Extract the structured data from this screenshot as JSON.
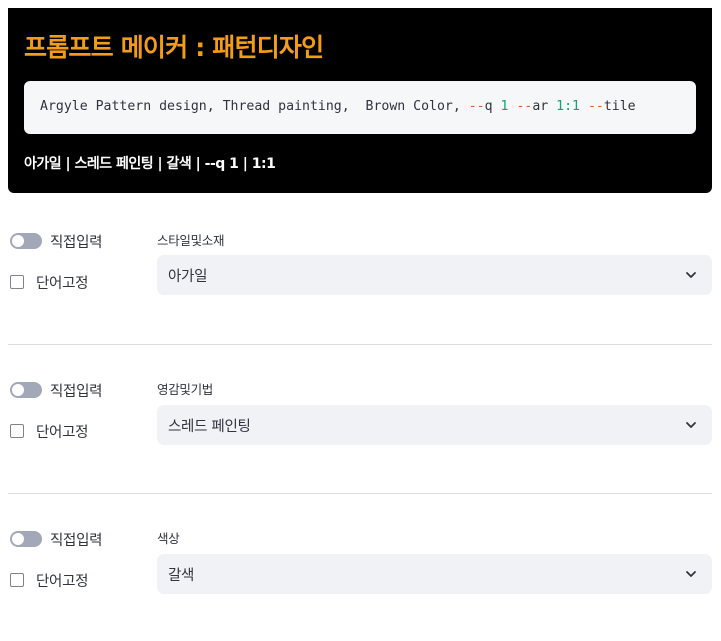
{
  "header": {
    "title": "프롬프트 메이커 : 패턴디자인",
    "code": {
      "text1": "Argyle Pattern design, Thread painting,  Brown Color, ",
      "op1": "--",
      "kw1": "q ",
      "num1": "1",
      "space1": " ",
      "op2": "--",
      "kw2": "ar ",
      "num2": "1:1",
      "space2": " ",
      "op3": "--",
      "kw3": "tile"
    },
    "summary": "아가일 | 스레드 페인팅 | 갈색 | --q 1 | 1:1"
  },
  "sections": [
    {
      "toggle_label": "직접입력",
      "checkbox_label": "단어고정",
      "field_label": "스타일및소재",
      "selected_value": "아가일"
    },
    {
      "toggle_label": "직접입력",
      "checkbox_label": "단어고정",
      "field_label": "영감및기법",
      "selected_value": "스레드 페인팅"
    },
    {
      "toggle_label": "직접입력",
      "checkbox_label": "단어고정",
      "field_label": "색상",
      "selected_value": "갈색"
    }
  ],
  "icons": {
    "chevron": "chevron-down-icon"
  },
  "colors": {
    "title": "#f39c1a",
    "header_bg": "#000000",
    "code_bg": "#f6f7f9",
    "select_bg": "#f0f2f6",
    "toggle_off": "#a3a8b8",
    "code_operator": "#d95f2b",
    "code_number": "#1a9e77"
  }
}
